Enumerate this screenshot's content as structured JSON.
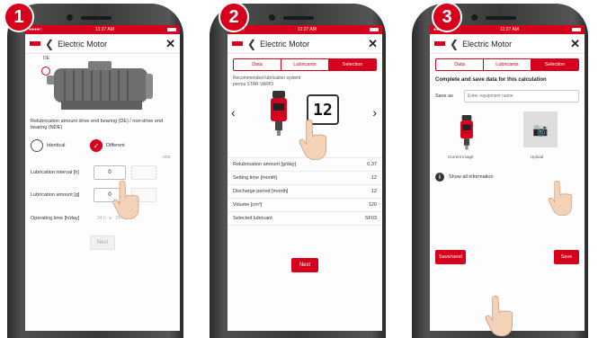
{
  "steps": [
    "1",
    "2",
    "3"
  ],
  "status": {
    "carrier": "●●●●○",
    "time": "11:27 AM"
  },
  "app": {
    "title": "Electric Motor"
  },
  "tabs": [
    "Data",
    "Lubricants",
    "Selection"
  ],
  "screen1": {
    "de_label": "DE",
    "question": "Relubrication amount drive end bearing (DE) / non-drive end bearing (NDE)",
    "option_identical": "Identical",
    "option_different": "Different",
    "col_nde": "NDE",
    "interval_label": "Lubrication interval [h]",
    "interval_value": "0",
    "amount_label": "Lubrication amount [g]",
    "amount_value": "0",
    "operating_label": "Operating time [h/day]",
    "operating_from": "24 h",
    "operating_to": "24 h",
    "next": "Next"
  },
  "screen2": {
    "recommended": "Recommended lubrication system",
    "product": "perma STAR VARIO",
    "display_value": "12",
    "rows": [
      {
        "label": "Relubrication amount [g/day]",
        "value": "0,37"
      },
      {
        "label": "Setting time [month]",
        "value": "12"
      },
      {
        "label": "Discharge period [month]",
        "value": "12"
      },
      {
        "label": "Volume [cm³]",
        "value": "120"
      },
      {
        "label": "Selected lubricant",
        "value": "SF03"
      }
    ],
    "next": "Next"
  },
  "screen3": {
    "heading": "Complete and save data for this calculation",
    "save_as": "Save as",
    "save_placeholder": "Enter equipment name",
    "current_image": "Current image",
    "upload": "Upload",
    "show_info": "Show all information",
    "save_send": "Save/send",
    "save": "Save"
  },
  "colors": {
    "accent": "#d6001c"
  }
}
